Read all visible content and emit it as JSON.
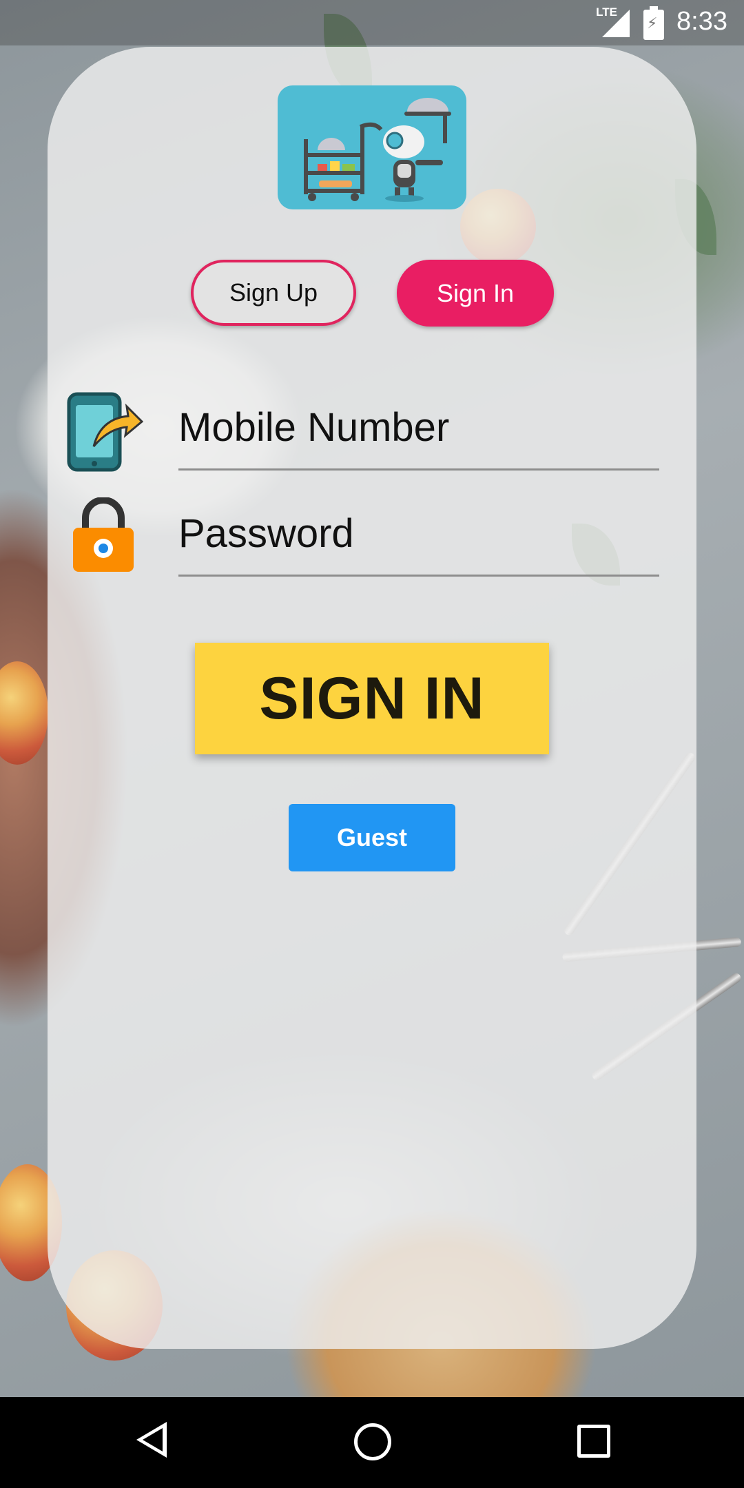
{
  "status_bar": {
    "time": "8:33",
    "network": "LTE"
  },
  "auth_tabs": {
    "signup_label": "Sign Up",
    "signin_label": "Sign In"
  },
  "form": {
    "mobile_placeholder": "Mobile Number",
    "password_placeholder": "Password"
  },
  "actions": {
    "signin_label": "SIGN IN",
    "guest_label": "Guest"
  },
  "colors": {
    "signin_tab": "#e91e63",
    "signin_button": "#fdd33f",
    "guest_button": "#2196f3",
    "logo_bg": "#4fbcd3"
  },
  "icons": {
    "logo": "restaurant-robot-logo",
    "mobile": "phone-share-icon",
    "password": "padlock-icon"
  }
}
